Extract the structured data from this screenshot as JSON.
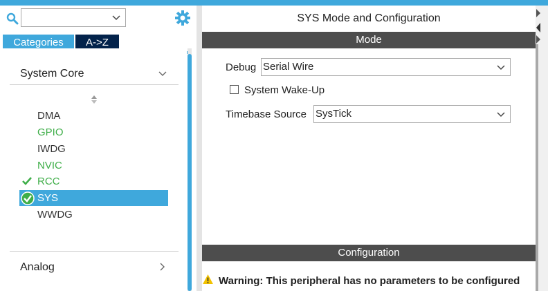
{
  "left_panel": {
    "search_value": "",
    "tabs": [
      {
        "label": "Categories",
        "active": true
      },
      {
        "label": "A->Z",
        "active": false
      }
    ],
    "section_system_core": "System Core",
    "items": [
      {
        "label": "DMA",
        "state": "plain"
      },
      {
        "label": "GPIO",
        "state": "green"
      },
      {
        "label": "IWDG",
        "state": "plain"
      },
      {
        "label": "NVIC",
        "state": "green"
      },
      {
        "label": "RCC",
        "state": "checked"
      },
      {
        "label": "SYS",
        "state": "selected"
      },
      {
        "label": "WWDG",
        "state": "plain"
      }
    ],
    "section_analog": "Analog"
  },
  "right_panel": {
    "title": "SYS Mode and Configuration",
    "mode_header": "Mode",
    "debug_label": "Debug",
    "debug_value": "Serial Wire",
    "wakeup_label": "System Wake-Up",
    "wakeup_checked": false,
    "timebase_label": "Timebase Source",
    "timebase_value": "SysTick",
    "config_header": "Configuration",
    "warning_text": "Warning: This peripheral has no parameters to be configured"
  },
  "colors": {
    "accent": "#3fa8dc",
    "tab_dark": "#03234b",
    "green": "#3fae49",
    "header_bar": "#4d4d4d",
    "warning": "#f2c200"
  },
  "icons": [
    "search-icon",
    "chevron-down-icon",
    "gear-icon",
    "sort-icon",
    "checkmark-icon",
    "check-circle-icon",
    "chevron-right-icon",
    "warning-icon"
  ]
}
